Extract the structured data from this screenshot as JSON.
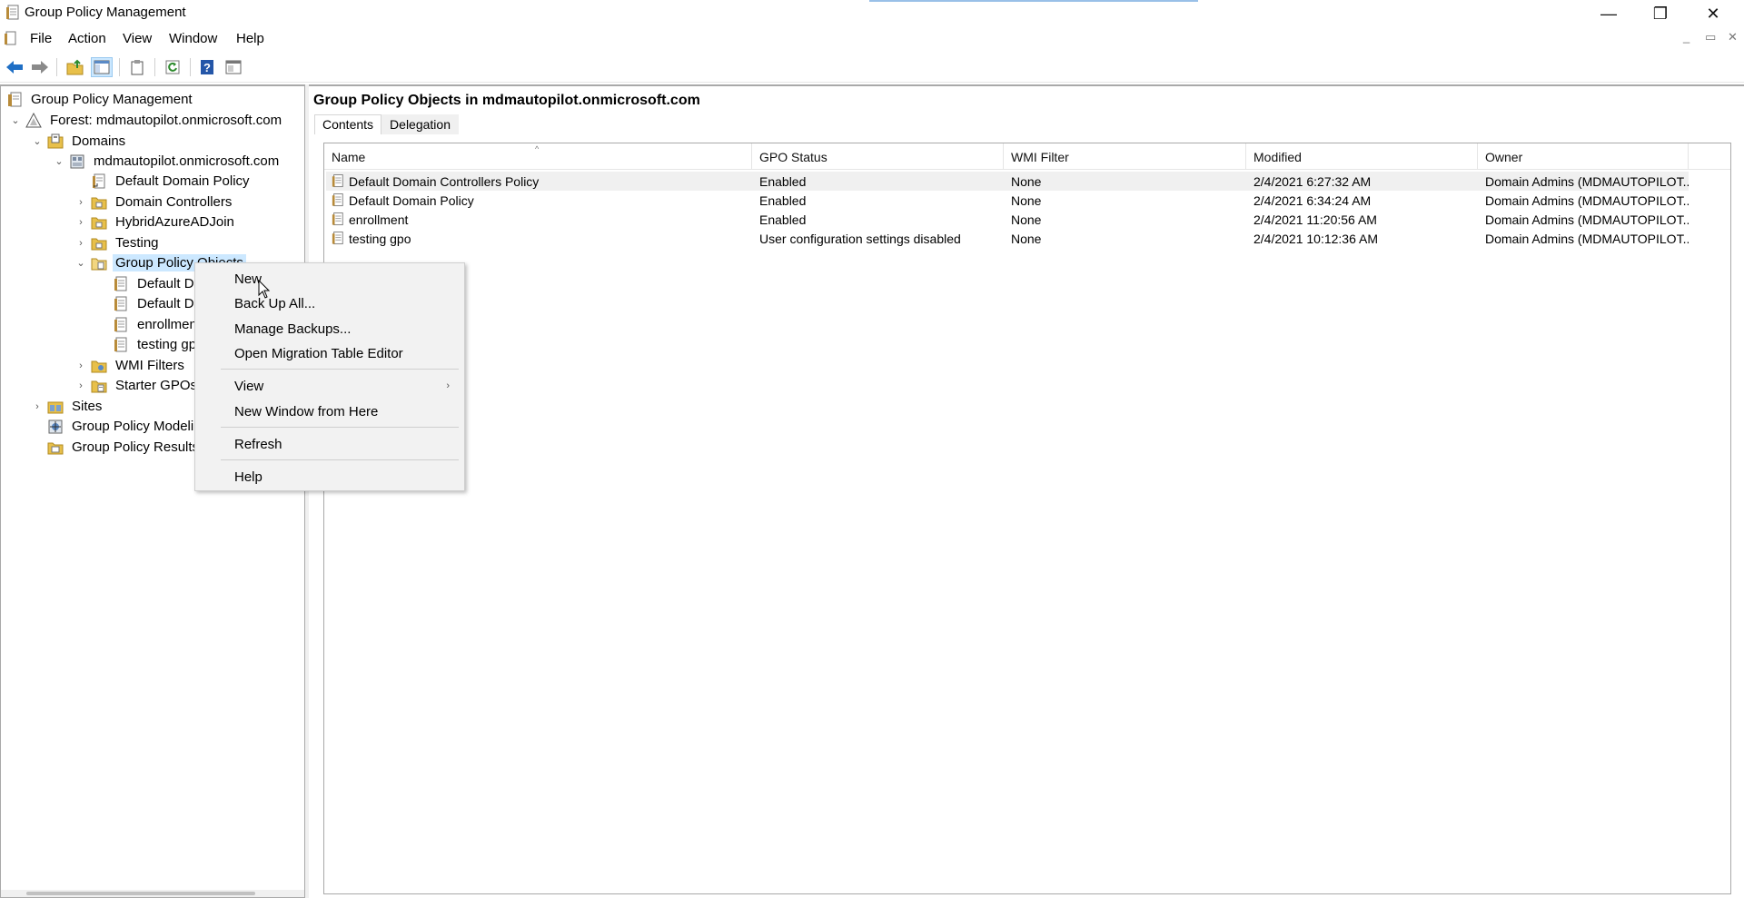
{
  "window": {
    "title": "Group Policy Management",
    "controls": {
      "minimize": "—",
      "maximize": "❐",
      "close": "✕"
    }
  },
  "menubar": {
    "items": [
      "File",
      "Action",
      "View",
      "Window",
      "Help"
    ],
    "mdi_controls": {
      "minimize": "_",
      "restore": "▭",
      "close": "✕"
    }
  },
  "toolbar": {
    "buttons": [
      "back-icon",
      "forward-icon",
      "up-folder-icon",
      "show-hide-tree-icon",
      "clipboard-icon",
      "refresh-icon",
      "help-icon",
      "console-window-icon"
    ]
  },
  "tree": {
    "root": "Group Policy Management",
    "forest": "Forest: mdmautopilot.onmicrosoft.com",
    "domains": "Domains",
    "domain": "mdmautopilot.onmicrosoft.com",
    "default_domain_policy": "Default Domain Policy",
    "domain_controllers": "Domain Controllers",
    "hybrid": "HybridAzureADJoin",
    "testing": "Testing",
    "gpo_container": "Group Policy Objects",
    "gpo_children": [
      "Default Domain Controllers Policy",
      "Default Domain Policy",
      "enrollment",
      "testing gpo"
    ],
    "wmi_filters": "WMI Filters",
    "starter_gpos": "Starter GPOs",
    "sites": "Sites",
    "modeling": "Group Policy Modeling",
    "results": "Group Policy Results"
  },
  "main": {
    "title": "Group Policy Objects in mdmautopilot.onmicrosoft.com",
    "tabs": [
      "Contents",
      "Delegation"
    ],
    "columns": [
      "Name",
      "GPO Status",
      "WMI Filter",
      "Modified",
      "Owner"
    ],
    "rows": [
      {
        "name": "Default Domain Controllers Policy",
        "status": "Enabled",
        "wmi": "None",
        "modified": "2/4/2021 6:27:32 AM",
        "owner": "Domain Admins (MDMAUTOPILOT..."
      },
      {
        "name": "Default Domain Policy",
        "status": "Enabled",
        "wmi": "None",
        "modified": "2/4/2021 6:34:24 AM",
        "owner": "Domain Admins (MDMAUTOPILOT..."
      },
      {
        "name": "enrollment",
        "status": "Enabled",
        "wmi": "None",
        "modified": "2/4/2021 11:20:56 AM",
        "owner": "Domain Admins (MDMAUTOPILOT..."
      },
      {
        "name": "testing gpo",
        "status": "User configuration settings disabled",
        "wmi": "None",
        "modified": "2/4/2021 10:12:36 AM",
        "owner": "Domain Admins (MDMAUTOPILOT..."
      }
    ]
  },
  "context_menu": {
    "items": [
      "New",
      "Back Up All...",
      "Manage Backups...",
      "Open Migration Table Editor",
      "View",
      "New Window from Here",
      "Refresh",
      "Help"
    ],
    "submenu_arrow": "›"
  },
  "colors": {
    "selection": "#cce8ff",
    "back_arrow": "#1f6fc5",
    "folder": "#e8c04a"
  }
}
